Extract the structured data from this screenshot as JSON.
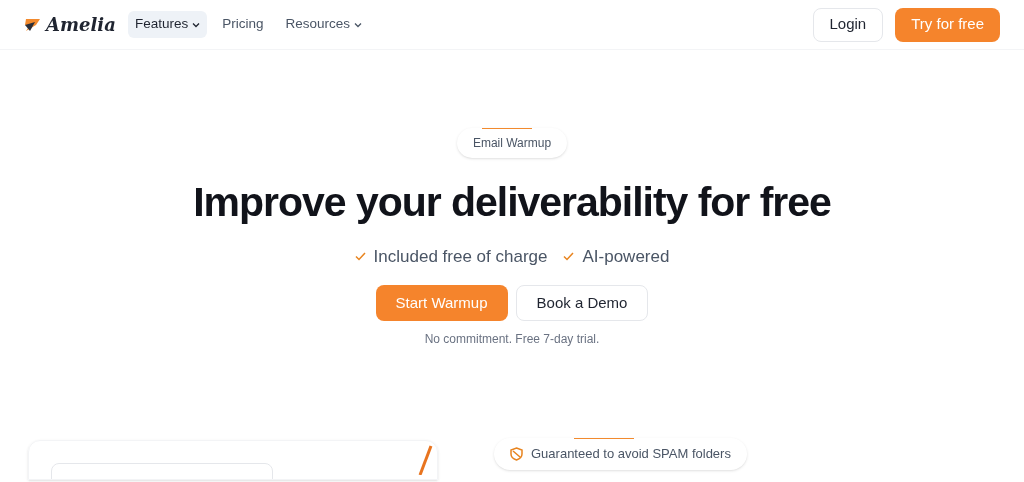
{
  "header": {
    "logo": "Amelia",
    "nav": [
      {
        "label": "Features",
        "kind": "dropdown",
        "selected": true
      },
      {
        "label": "Pricing",
        "kind": "link",
        "selected": false
      },
      {
        "label": "Resources",
        "kind": "dropdown",
        "selected": false
      }
    ],
    "login": "Login",
    "cta": "Try for free"
  },
  "hero": {
    "badge": "Email Warmup",
    "title": "Improve your deliverability for free",
    "features": [
      "Included free of charge",
      "AI-powered"
    ],
    "primary_button": "Start Warmup",
    "secondary_button": "Book a Demo",
    "note": "No commitment. Free 7-day trial."
  },
  "lower": {
    "badge": "Guaranteed to avoid SPAM folders"
  }
}
